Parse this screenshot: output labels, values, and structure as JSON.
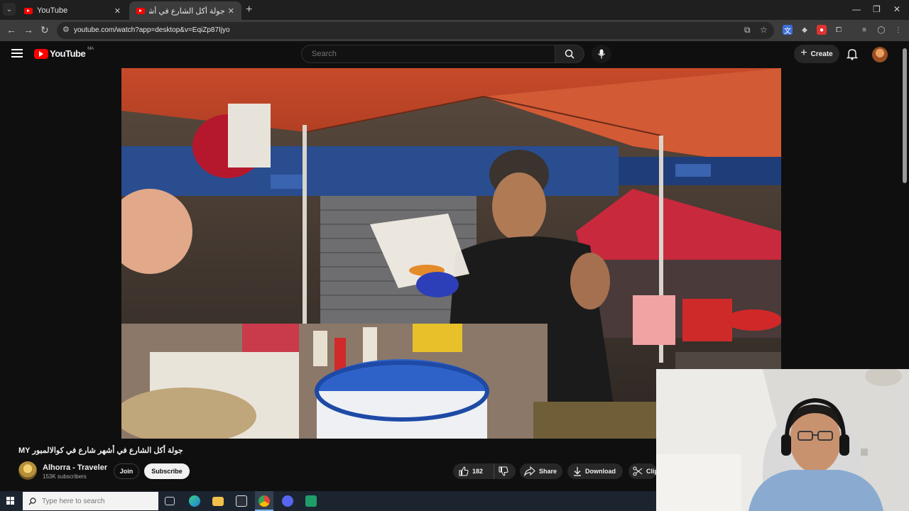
{
  "browser": {
    "tabs": [
      {
        "title": "YouTube",
        "active": false
      },
      {
        "title": "جولة أكل الشارع في أشهر شا",
        "active": true
      }
    ],
    "url": "youtube.com/watch?app=desktop&v=EqiZp87Ijyo"
  },
  "youtube": {
    "logo_text": "YouTube",
    "country_code": "MA",
    "search_placeholder": "Search",
    "create_label": "Create"
  },
  "video": {
    "title": "جولة أكل الشارع في أشهر شارع في كوالالمبور MY",
    "channel_name": "Alhorra - Traveler",
    "subscribers": "153K subscribers",
    "join_label": "Join",
    "subscribe_label": "Subscribe",
    "like_count": "182",
    "share_label": "Share",
    "download_label": "Download",
    "clip_label": "Clip"
  },
  "taskbar": {
    "search_placeholder": "Type here to search"
  },
  "colors": {
    "brand_red": "#ff0000",
    "page_bg": "#0f0f0f",
    "button_bg": "#272727"
  }
}
